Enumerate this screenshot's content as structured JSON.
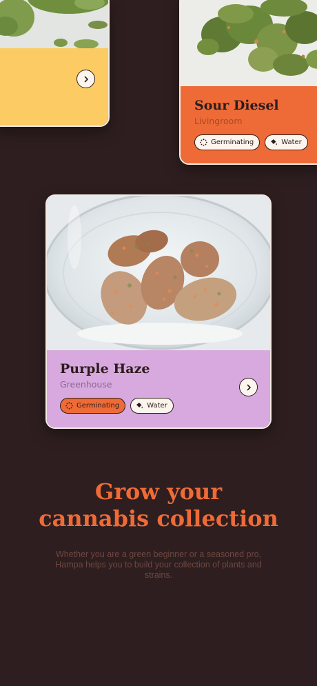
{
  "colors": {
    "background": "#2e1e1f",
    "card_yellow": "#fccb63",
    "card_orange": "#ee6b37",
    "card_purple": "#d7a9de",
    "accent": "#ee6b37",
    "chip_light": "#fbf5ee",
    "text_dark": "#2d1c1d"
  },
  "cards": [
    {
      "name": "",
      "location": "",
      "color": "#fccb63"
    },
    {
      "name": "Sour Diesel",
      "location": "Livingroom",
      "color": "#ee6b37",
      "tags": [
        {
          "label": "Germinating",
          "icon": "germinating-icon",
          "active": false
        },
        {
          "label": "Water",
          "icon": "water-icon",
          "active": false
        }
      ]
    },
    {
      "name": "Purple Haze",
      "location": "Greenhouse",
      "color": "#d7a9de",
      "tags": [
        {
          "label": "Germinating",
          "icon": "germinating-icon",
          "active": true
        },
        {
          "label": "Water",
          "icon": "water-icon",
          "active": false
        }
      ]
    }
  ],
  "headline": {
    "line1": "Grow your",
    "line2": "cannabis collection"
  },
  "description": "Whether you are a green beginner or a seasoned pro, Hampa helps you to build your collection of plants and strains."
}
